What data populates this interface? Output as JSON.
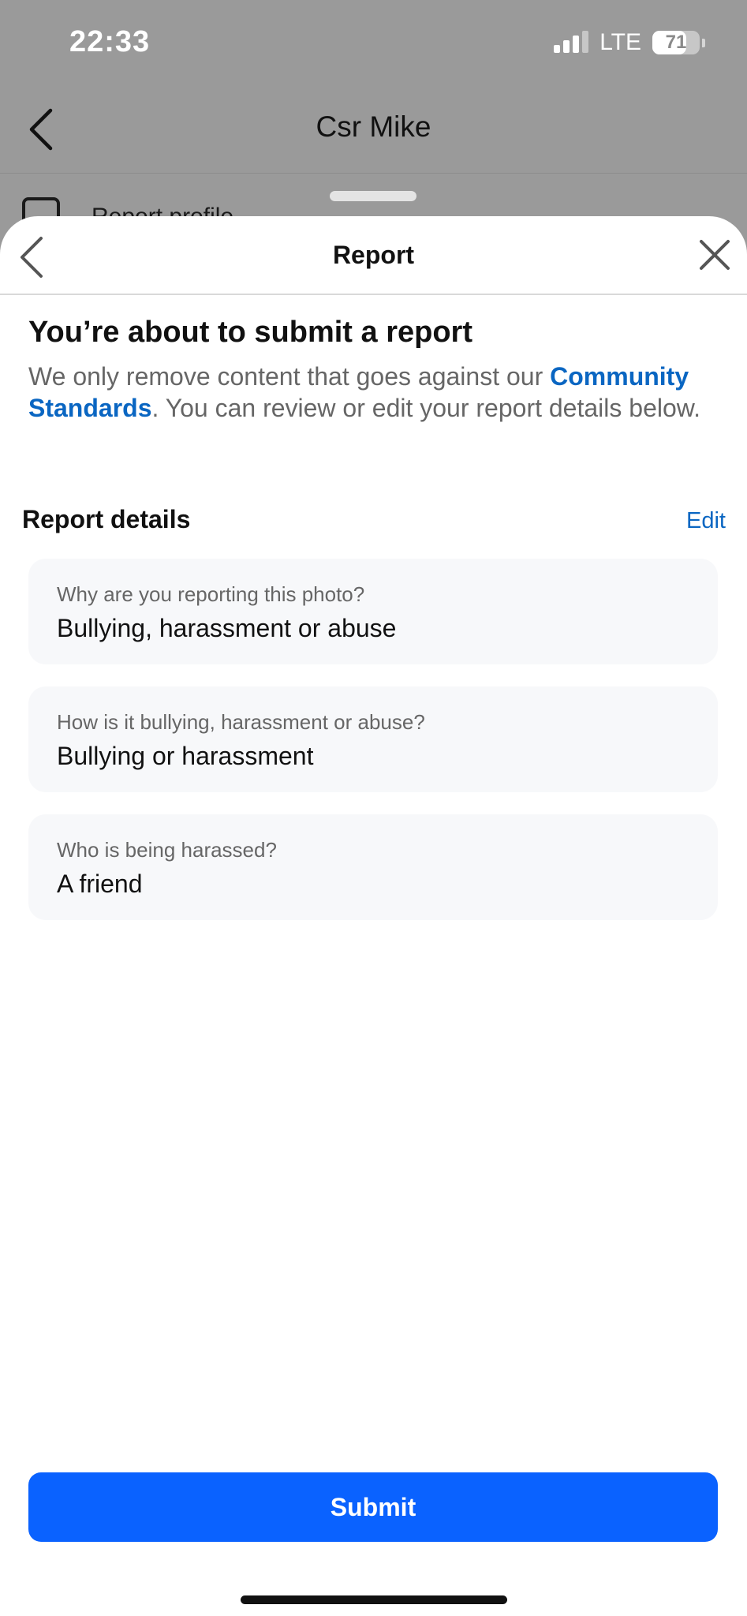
{
  "status_bar": {
    "time": "22:33",
    "network": "LTE",
    "battery": "71",
    "battery_level": 0.71
  },
  "background_page": {
    "title": "Csr Mike",
    "row_label": "Report profile"
  },
  "sheet": {
    "title": "Report",
    "intro": {
      "title": "You’re about to submit a report",
      "text_before": "We only remove content that goes against our ",
      "link": "Community Standards",
      "text_after": ". You can review or edit your report details below."
    },
    "details_heading": "Report details",
    "edit_label": "Edit",
    "details": [
      {
        "question": "Why are you reporting this photo?",
        "answer": "Bullying, harassment or abuse"
      },
      {
        "question": "How is it bullying, harassment or abuse?",
        "answer": "Bullying or harassment"
      },
      {
        "question": "Who is being harassed?",
        "answer": "A friend"
      }
    ],
    "submit_label": "Submit"
  },
  "colors": {
    "accent_link": "#0a66c2",
    "submit_button": "#0a62ff",
    "card_background": "#f7f8fa",
    "overlay_dim": "#9a9a9a"
  },
  "icons": [
    "signal-icon",
    "battery-icon",
    "back-chevron-icon",
    "close-x-icon",
    "report-profile-icon"
  ]
}
